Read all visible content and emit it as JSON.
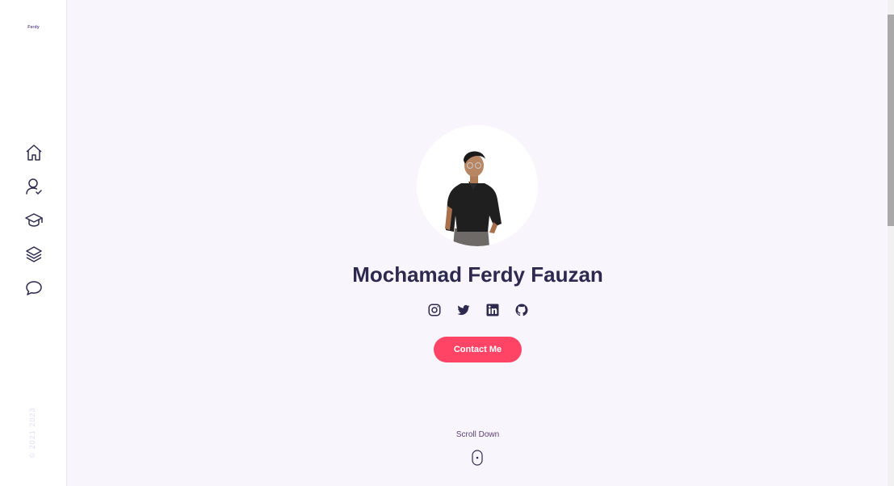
{
  "sidebar": {
    "logo_text": "Ferdy",
    "nav_items": [
      {
        "icon": "home-icon",
        "label": "Home"
      },
      {
        "icon": "user-check-icon",
        "label": "About"
      },
      {
        "icon": "graduation-cap-icon",
        "label": "Education"
      },
      {
        "icon": "layers-icon",
        "label": "Portfolio"
      },
      {
        "icon": "message-icon",
        "label": "Contact"
      }
    ],
    "copyright": "© 2021 2023"
  },
  "hero": {
    "name": "Mochamad Ferdy Fauzan",
    "socials": [
      "instagram-icon",
      "twitter-icon",
      "linkedin-icon",
      "github-icon"
    ],
    "contact_label": "Contact Me",
    "scroll_label": "Scroll Down"
  },
  "colors": {
    "background": "#f8f5fc",
    "accent": "#ff4466",
    "text": "#2e2a4f"
  }
}
